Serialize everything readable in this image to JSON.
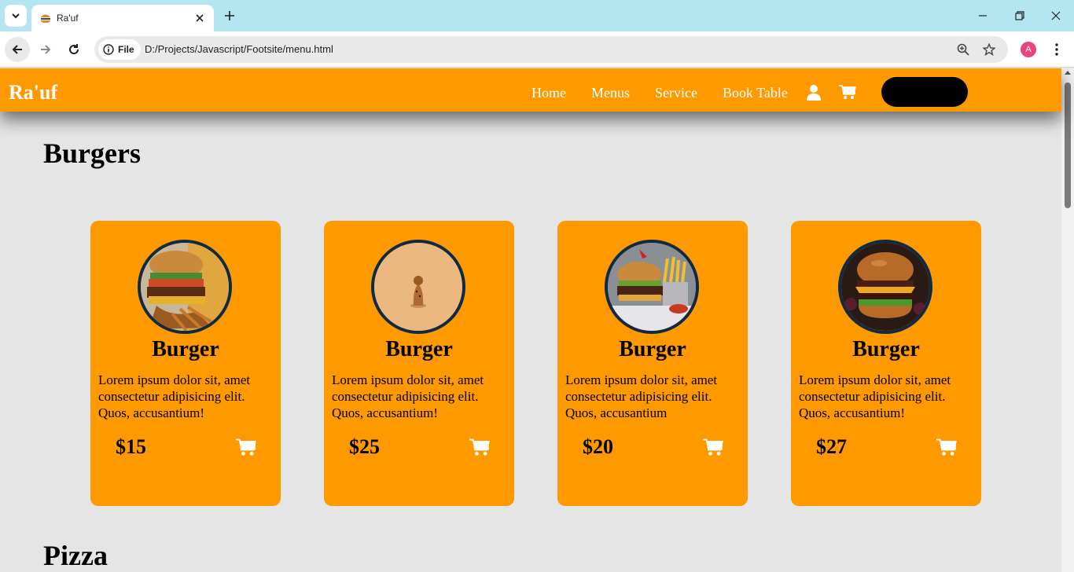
{
  "browser": {
    "tab_title": "Ra'uf",
    "site_chip_label": "File",
    "url": "D:/Projects/Javascript/Footsite/menu.html",
    "profile_initial": "A",
    "profile_color": "#e8457a"
  },
  "site": {
    "logo": "Ra'uf",
    "accent_color": "#ff9900",
    "nav": [
      {
        "label": "Home"
      },
      {
        "label": "Menus"
      },
      {
        "label": "Service"
      },
      {
        "label": "Book Table"
      }
    ],
    "icons": [
      "user-icon",
      "cart-icon"
    ],
    "header_button_label": ""
  },
  "sections": [
    {
      "title": "Burgers",
      "items": [
        {
          "name": "Burger",
          "description": "Lorem ipsum dolor sit, amet consectetur adipisicing elit. Quos, accusantium!",
          "price": "$15",
          "image": "burger-with-fries"
        },
        {
          "name": "Burger",
          "description": "Lorem ipsum dolor sit, amet consectetur adipisicing elit. Quos, accusantium!",
          "price": "$25",
          "image": "small-figure-on-peach"
        },
        {
          "name": "Burger",
          "description": "Lorem ipsum dolor sit, amet consectetur adipisicing elit. Quos, accusantium",
          "price": "$20",
          "image": "burger-and-fries-basket"
        },
        {
          "name": "Burger",
          "description": "Lorem ipsum dolor sit, amet consectetur adipisicing elit. Quos, accusantium!",
          "price": "$27",
          "image": "cheeseburger-dark-bg"
        }
      ]
    },
    {
      "title": "Pizza"
    }
  ]
}
